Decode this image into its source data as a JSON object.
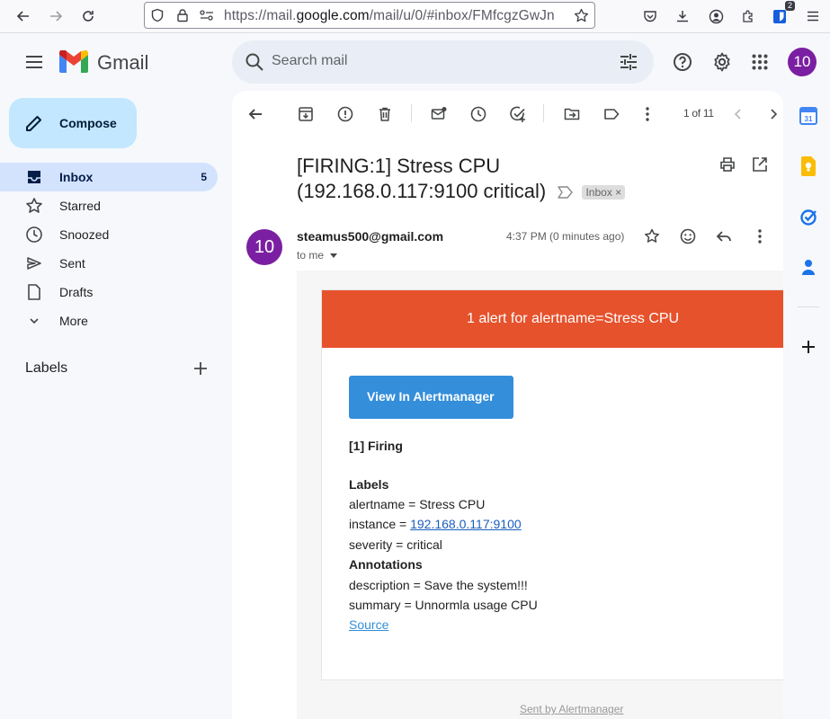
{
  "browser": {
    "url_prefix": "https://mail.",
    "url_domain": "google.com",
    "url_suffix": "/mail/u/0/#inbox/FMfcgzGwJn",
    "extension_badge": "2"
  },
  "app": {
    "name": "Gmail",
    "search_placeholder": "Search mail",
    "account_initials": "10"
  },
  "sidebar": {
    "compose_label": "Compose",
    "items": [
      {
        "label": "Inbox",
        "count": "5"
      },
      {
        "label": "Starred"
      },
      {
        "label": "Snoozed"
      },
      {
        "label": "Sent"
      },
      {
        "label": "Drafts"
      },
      {
        "label": "More"
      }
    ],
    "labels_heading": "Labels"
  },
  "toolbar": {
    "pagination": "1 of 11"
  },
  "message": {
    "subject": "[FIRING:1] Stress CPU (192.168.0.117:9100 critical)",
    "label_chip": "Inbox",
    "label_chip_close": "×",
    "sender_initials": "10",
    "sender": "steamus500@gmail.com",
    "recipient": "to me",
    "time": "4:37 PM (0 minutes ago)"
  },
  "alert": {
    "banner": "1 alert for alertname=Stress CPU",
    "banner_color": "#e6522c",
    "button_label": "View In Alertmanager",
    "button_color": "#348eda",
    "firing_heading": "[1] Firing",
    "labels_heading": "Labels",
    "label_alertname": "alertname = Stress CPU",
    "label_instance_prefix": "instance = ",
    "label_instance_link": "192.168.0.117:9100",
    "label_severity": "severity = critical",
    "annotations_heading": "Annotations",
    "annotation_description": "description = Save the system!!!",
    "annotation_summary": "summary = Unnormla usage CPU",
    "source_link": "Source",
    "footer": "Sent by Alertmanager"
  },
  "colors": {
    "avatar": "#7b1fa2",
    "compose_bg": "#c2e7ff",
    "active_nav_bg": "#d3e3fd"
  }
}
